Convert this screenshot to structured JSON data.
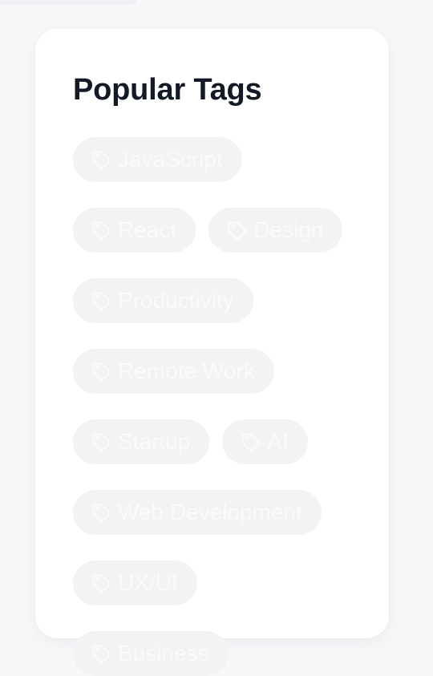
{
  "widget": {
    "title": "Popular Tags",
    "tags": [
      {
        "label": "JavaScript",
        "icon": "tag-icon"
      },
      {
        "label": "React",
        "icon": "tag-icon"
      },
      {
        "label": "Design",
        "icon": "tag-icon"
      },
      {
        "label": "Productivity",
        "icon": "tag-icon"
      },
      {
        "label": "Remote Work",
        "icon": "tag-icon"
      },
      {
        "label": "Startup",
        "icon": "tag-icon"
      },
      {
        "label": "AI",
        "icon": "tag-icon"
      },
      {
        "label": "Web Development",
        "icon": "tag-icon"
      },
      {
        "label": "UX/UI",
        "icon": "tag-icon"
      },
      {
        "label": "Business",
        "icon": "tag-icon"
      }
    ]
  },
  "colors": {
    "background": "#f7f8fa",
    "card": "#ffffff",
    "title": "#131a26",
    "tag_background": "#f2f3f5",
    "tag_text": "#fafafb"
  }
}
